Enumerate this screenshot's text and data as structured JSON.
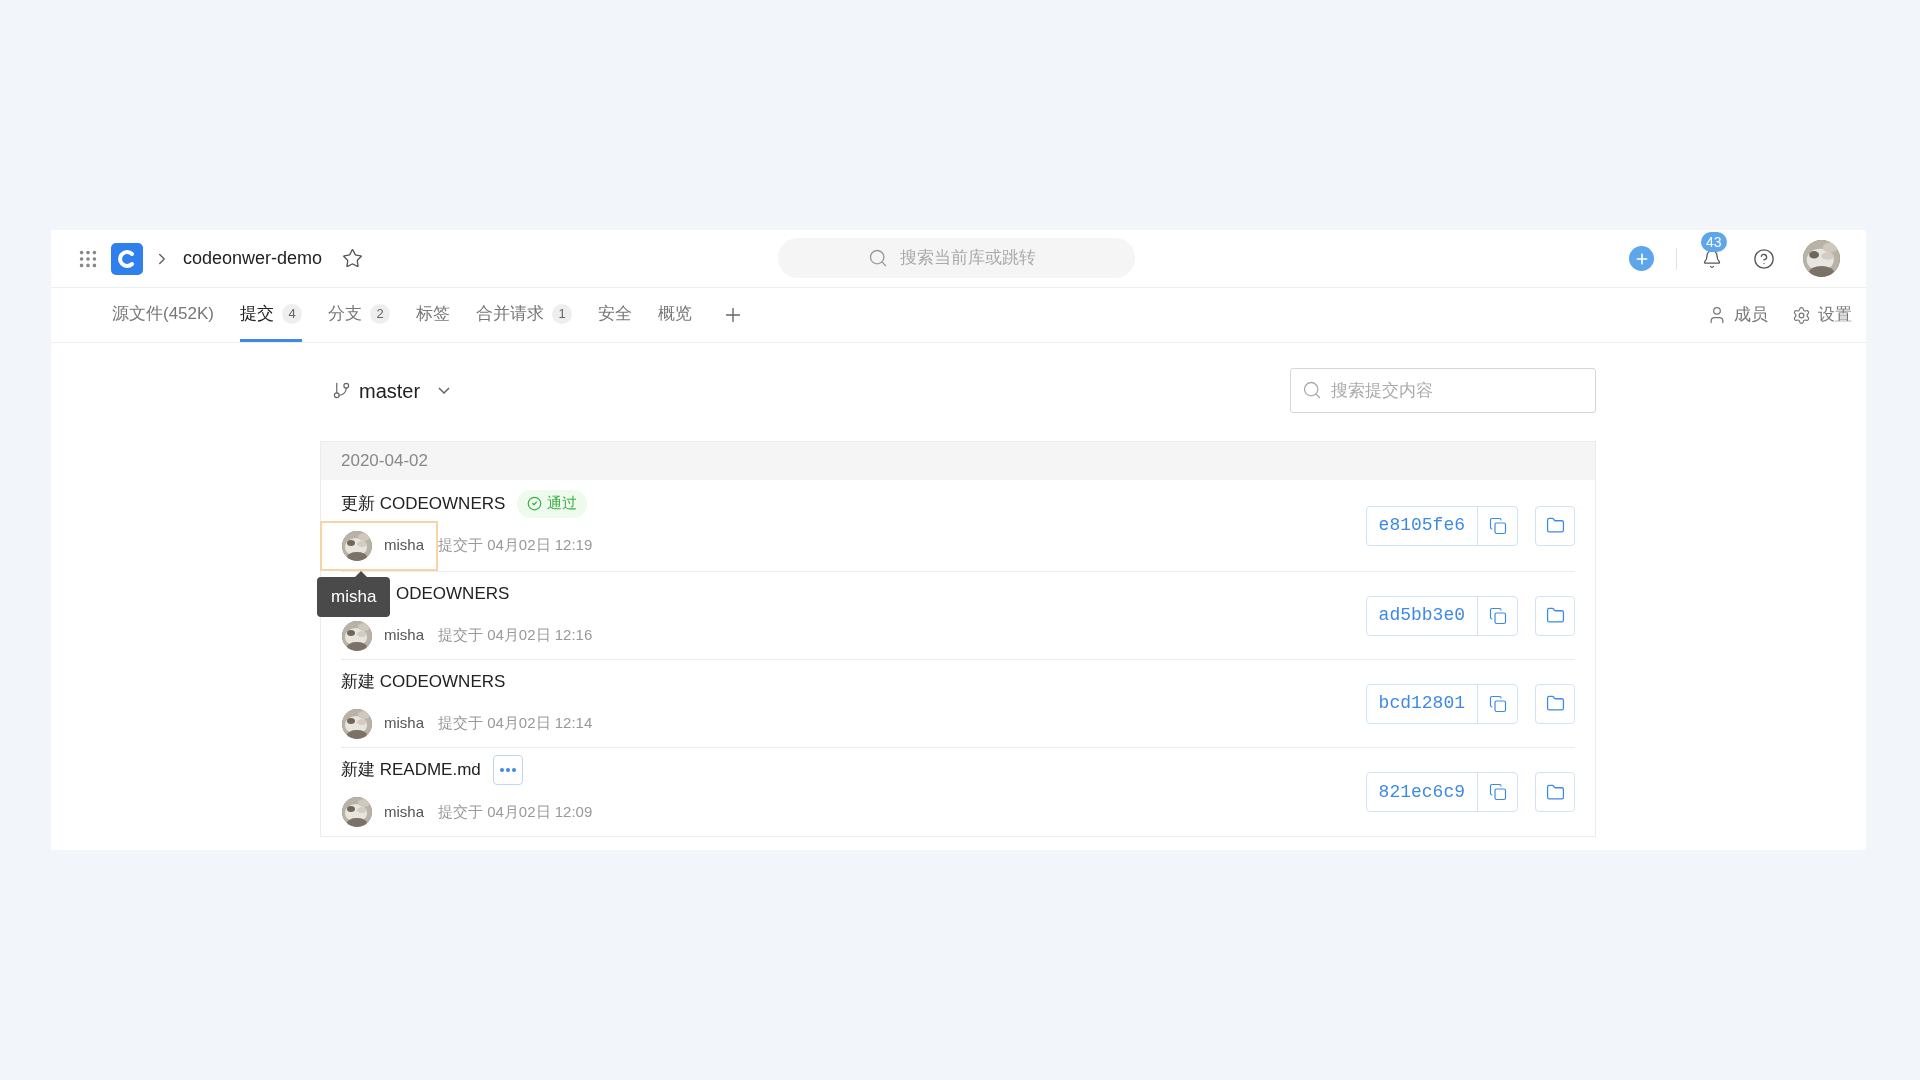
{
  "header": {
    "project": "codeonwer-demo",
    "search": {
      "placeholder": "搜索当前库或跳转"
    },
    "notifications": "43"
  },
  "tabs": [
    {
      "label": "源文件(452K)",
      "selected": false
    },
    {
      "label": "提交",
      "count": "4",
      "selected": true
    },
    {
      "label": "分支",
      "count": "2",
      "selected": false
    },
    {
      "label": "标签",
      "selected": false
    },
    {
      "label": "合并请求",
      "count": "1",
      "selected": false
    },
    {
      "label": "安全",
      "selected": false
    },
    {
      "label": "概览",
      "selected": false
    }
  ],
  "tab_actions": [
    {
      "kind": "members",
      "label": "成员"
    },
    {
      "kind": "settings",
      "label": "设置"
    }
  ],
  "branch": "master",
  "commit_search": {
    "placeholder": "搜索提交内容"
  },
  "date": "2020-04-02",
  "commits": [
    {
      "title": "更新 CODEOWNERS",
      "status": {
        "kind": "passed",
        "label": "通过"
      },
      "author": "misha",
      "hovered": true,
      "tooltip": "misha",
      "time": "提交于 04月02日 12:19",
      "hash": "e8105fe6"
    },
    {
      "title": "ODEOWNERS",
      "title_covered": true,
      "author": "misha",
      "hovered": false,
      "time": "提交于 04月02日 12:16",
      "hash": "ad5bb3e0"
    },
    {
      "title": "新建 CODEOWNERS",
      "author": "misha",
      "hovered": false,
      "time": "提交于 04月02日 12:14",
      "hash": "bcd12801"
    },
    {
      "title": "新建 README.md",
      "status": {
        "kind": "pending"
      },
      "author": "misha",
      "hovered": false,
      "time": "提交于 04月02日 12:09",
      "hash": "821ec6c9"
    }
  ]
}
